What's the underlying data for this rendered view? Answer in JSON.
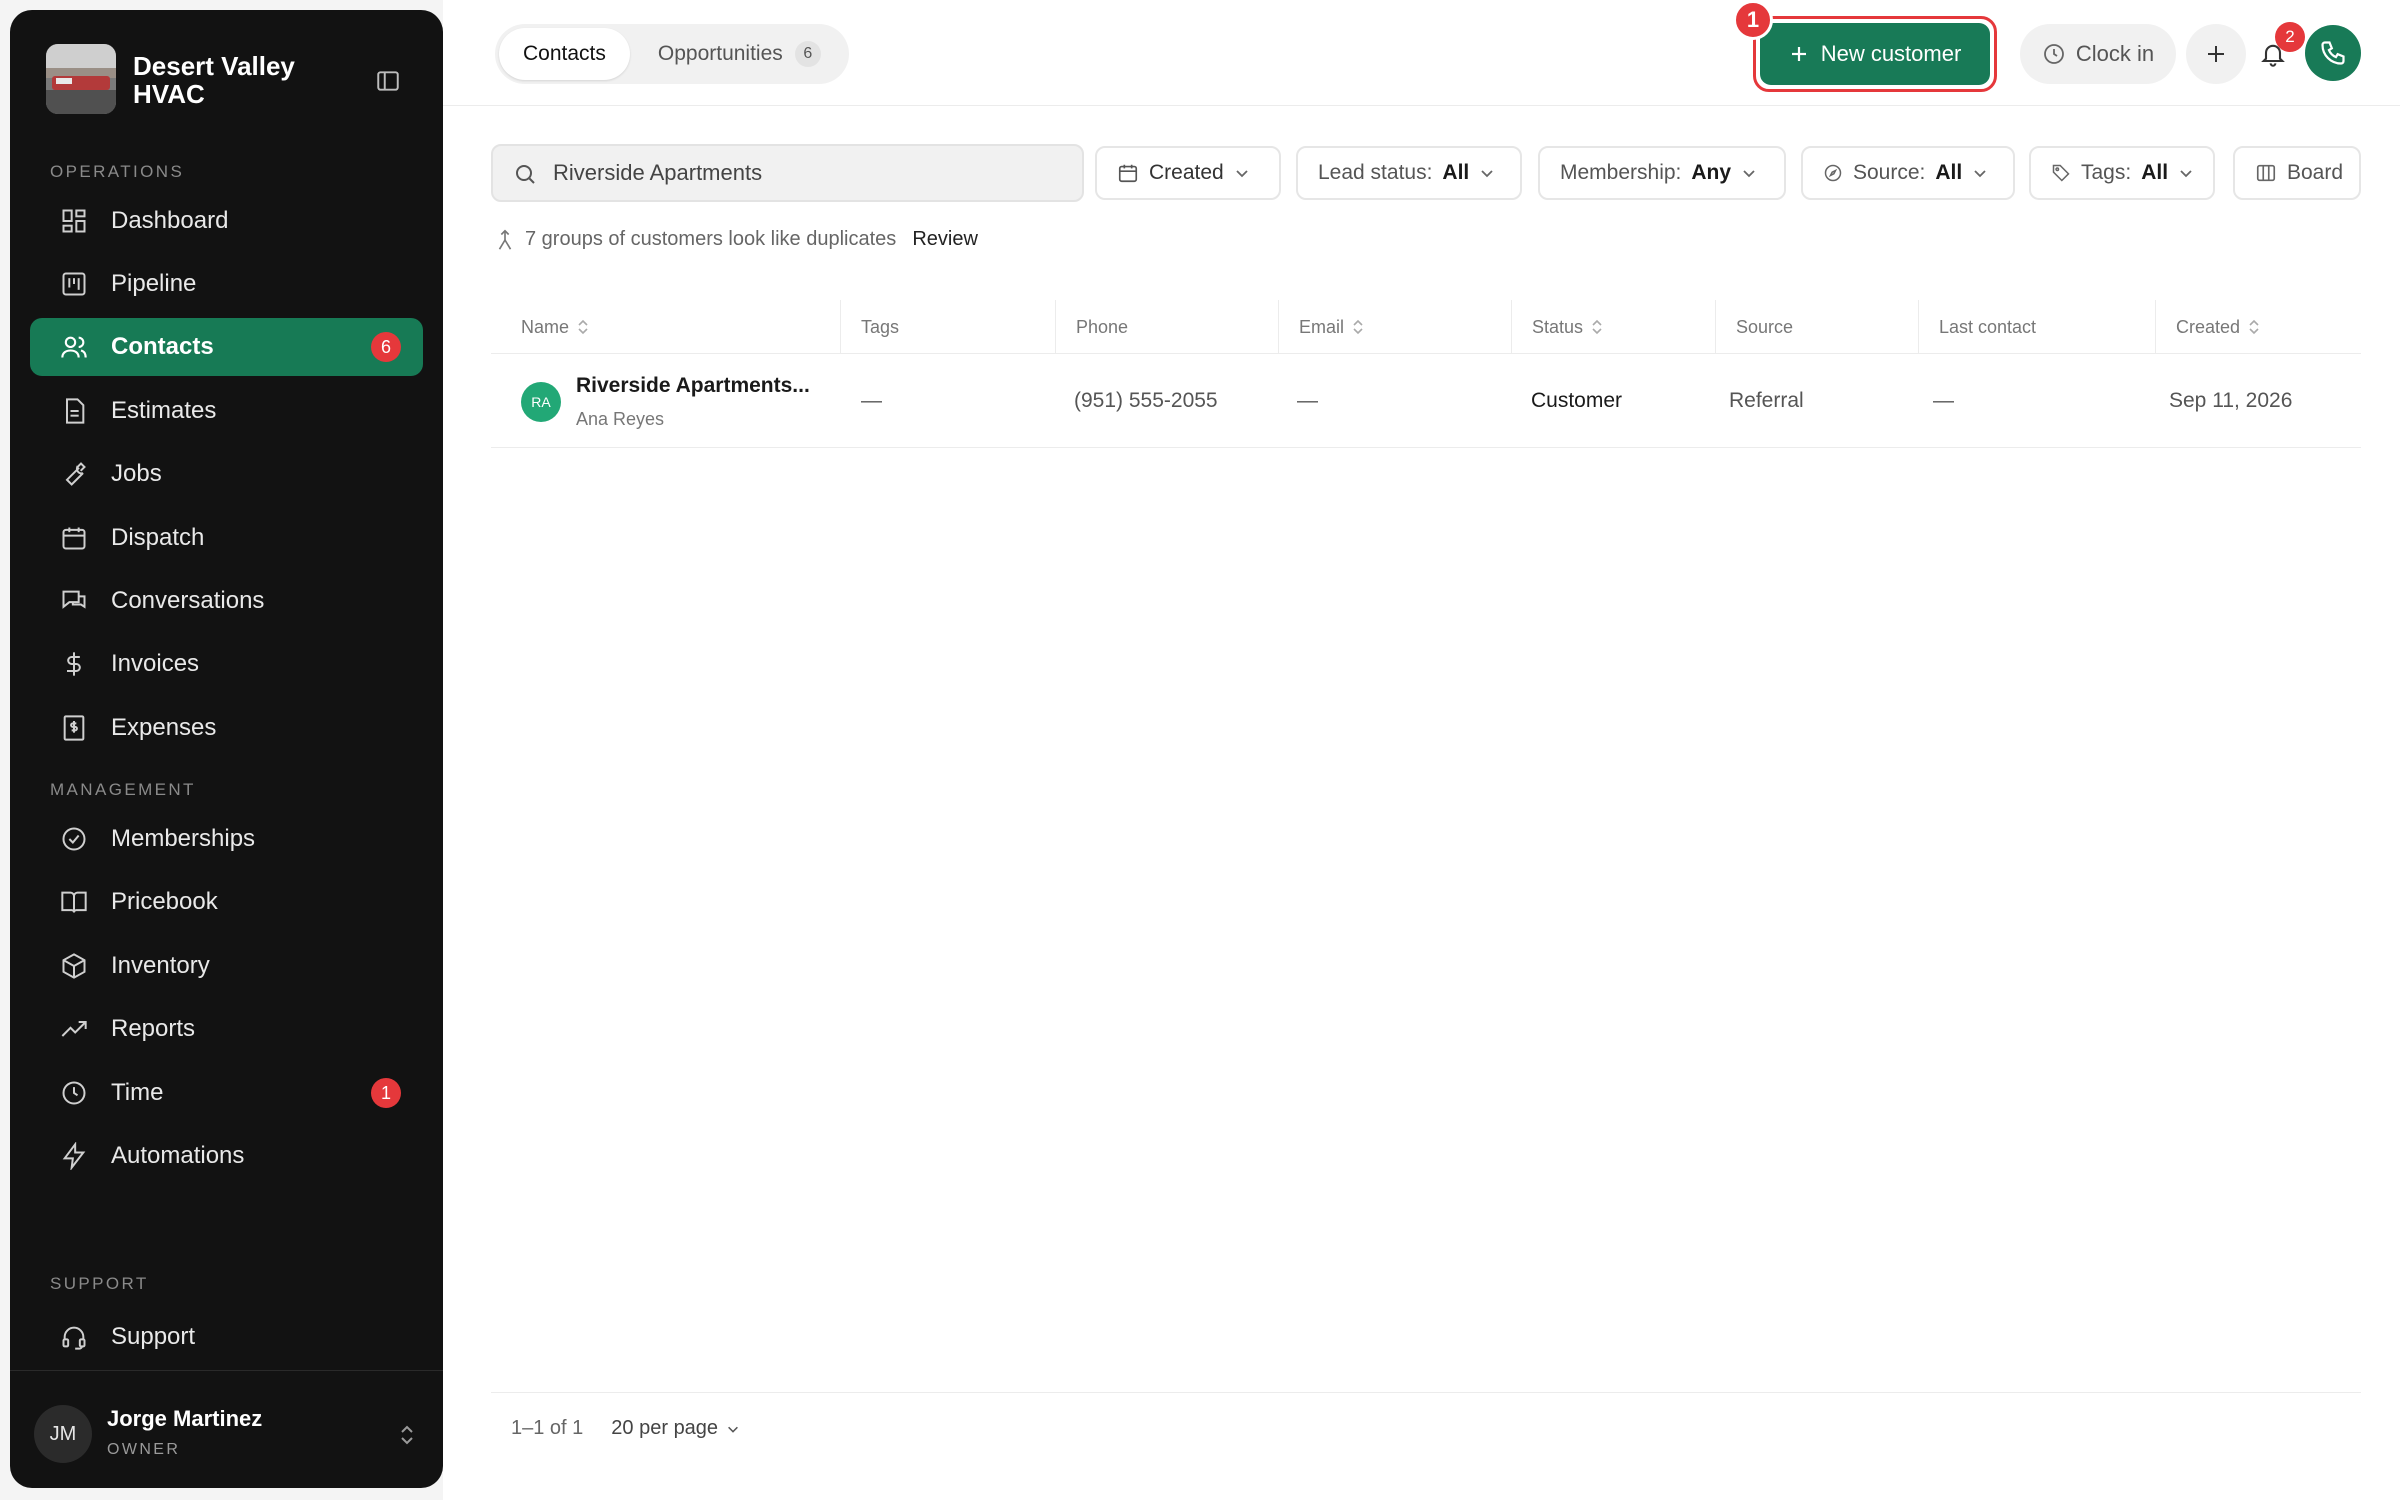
{
  "brand": {
    "name": "Desert Valley HVAC"
  },
  "sidebar": {
    "sections": {
      "operations": "OPERATIONS",
      "management": "MANAGEMENT",
      "support": "SUPPORT"
    },
    "items": [
      {
        "label": "Dashboard",
        "icon": "dashboard-icon"
      },
      {
        "label": "Pipeline",
        "icon": "pipeline-icon"
      },
      {
        "label": "Contacts",
        "icon": "contacts-icon",
        "badge": "6",
        "active": true
      },
      {
        "label": "Estimates",
        "icon": "estimates-icon"
      },
      {
        "label": "Jobs",
        "icon": "wrench-icon"
      },
      {
        "label": "Dispatch",
        "icon": "calendar-icon"
      },
      {
        "label": "Conversations",
        "icon": "chat-icon"
      },
      {
        "label": "Invoices",
        "icon": "dollar-icon"
      },
      {
        "label": "Expenses",
        "icon": "receipt-icon"
      },
      {
        "label": "Memberships",
        "icon": "badge-check-icon"
      },
      {
        "label": "Pricebook",
        "icon": "book-icon"
      },
      {
        "label": "Inventory",
        "icon": "box-icon"
      },
      {
        "label": "Reports",
        "icon": "trend-icon"
      },
      {
        "label": "Time",
        "icon": "clock-icon",
        "badge": "1"
      },
      {
        "label": "Automations",
        "icon": "bolt-icon"
      },
      {
        "label": "Support",
        "icon": "headset-icon"
      }
    ]
  },
  "user": {
    "initials": "JM",
    "name": "Jorge Martinez",
    "role": "OWNER"
  },
  "header": {
    "tabs": [
      {
        "label": "Contacts",
        "active": true
      },
      {
        "label": "Opportunities",
        "count": "6"
      }
    ],
    "new_customer_label": "New customer",
    "step_badge": "1",
    "clock_in_label": "Clock in",
    "notifications_count": "2"
  },
  "filters": {
    "search_value": "Riverside Apartments",
    "created_label": "Created",
    "lead_status_label": "Lead status:",
    "lead_status_value": "All",
    "membership_label": "Membership:",
    "membership_value": "Any",
    "source_label": "Source:",
    "source_value": "All",
    "tags_label": "Tags:",
    "tags_value": "All",
    "board_label": "Board"
  },
  "duplicates": {
    "text": "7 groups of customers look like duplicates",
    "action": "Review"
  },
  "table": {
    "columns": [
      "Name",
      "Tags",
      "Phone",
      "Email",
      "Status",
      "Source",
      "Last contact",
      "Created"
    ],
    "rows": [
      {
        "initials": "RA",
        "name": "Riverside Apartments...",
        "contact": "Ana Reyes",
        "tags": "—",
        "phone": "(951) 555-2055",
        "email": "—",
        "status": "Customer",
        "source": "Referral",
        "last_contact": "—",
        "created": "Sep 11, 2026"
      }
    ]
  },
  "pagination": {
    "range": "1–1 of 1",
    "per_page": "20 per page"
  },
  "colors": {
    "accent": "#187a57",
    "badge": "#e5383b",
    "sidebar_bg": "#121212"
  }
}
